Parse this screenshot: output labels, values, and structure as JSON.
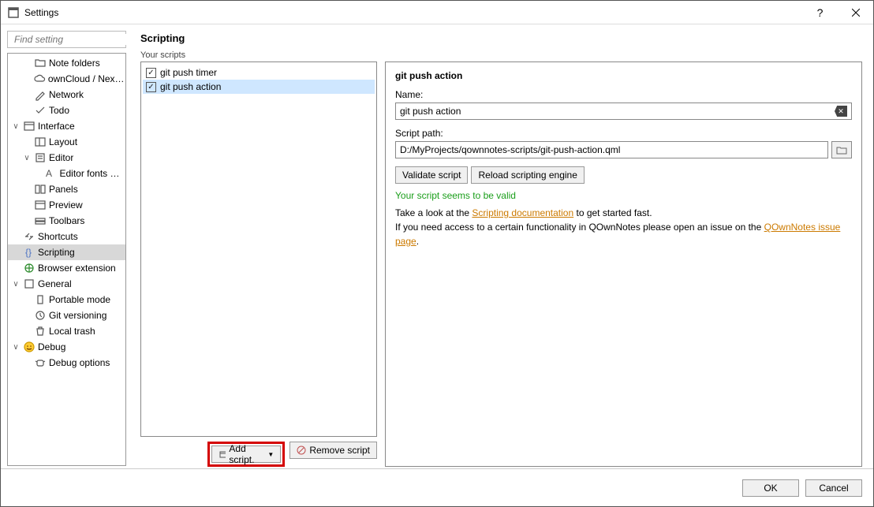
{
  "window": {
    "title": "Settings"
  },
  "search": {
    "placeholder": "Find setting"
  },
  "tree": [
    {
      "depth": 1,
      "exp": "",
      "icon": "folder",
      "label": "Note folders"
    },
    {
      "depth": 1,
      "exp": "",
      "icon": "cloud",
      "label": "ownCloud / Nextcl…"
    },
    {
      "depth": 1,
      "exp": "",
      "icon": "pencil",
      "label": "Network"
    },
    {
      "depth": 1,
      "exp": "",
      "icon": "check",
      "label": "Todo"
    },
    {
      "depth": 0,
      "exp": "∨",
      "icon": "window",
      "label": "Interface"
    },
    {
      "depth": 1,
      "exp": "",
      "icon": "layout",
      "label": "Layout"
    },
    {
      "depth": 1,
      "exp": "∨",
      "icon": "editor",
      "label": "Editor"
    },
    {
      "depth": 2,
      "exp": "",
      "icon": "font",
      "label": "Editor fonts & …"
    },
    {
      "depth": 1,
      "exp": "",
      "icon": "panels",
      "label": "Panels"
    },
    {
      "depth": 1,
      "exp": "",
      "icon": "preview",
      "label": "Preview"
    },
    {
      "depth": 1,
      "exp": "",
      "icon": "toolbar",
      "label": "Toolbars"
    },
    {
      "depth": 0,
      "exp": "",
      "icon": "shortcut",
      "label": "Shortcuts"
    },
    {
      "depth": 0,
      "exp": "",
      "icon": "script",
      "label": "Scripting",
      "selected": true
    },
    {
      "depth": 0,
      "exp": "",
      "icon": "globe",
      "label": "Browser extension"
    },
    {
      "depth": 0,
      "exp": "∨",
      "icon": "general",
      "label": "General"
    },
    {
      "depth": 1,
      "exp": "",
      "icon": "usb",
      "label": "Portable mode"
    },
    {
      "depth": 1,
      "exp": "",
      "icon": "clock",
      "label": "Git versioning"
    },
    {
      "depth": 1,
      "exp": "",
      "icon": "trash",
      "label": "Local trash"
    },
    {
      "depth": 0,
      "exp": "∨",
      "icon": "smile",
      "label": "Debug"
    },
    {
      "depth": 1,
      "exp": "",
      "icon": "bug",
      "label": "Debug options"
    }
  ],
  "main": {
    "heading": "Scripting",
    "sub": "Your scripts",
    "scripts": [
      {
        "label": "git push timer",
        "checked": true,
        "selected": false
      },
      {
        "label": "git push action",
        "checked": true,
        "selected": true
      }
    ],
    "add_label": "Add script.",
    "remove_label": "Remove script"
  },
  "detail": {
    "title": "git push action",
    "name_label": "Name:",
    "name_value": "git push action",
    "path_label": "Script path:",
    "path_value": "D:/MyProjects/qownnotes-scripts/git-push-action.qml",
    "validate": "Validate script",
    "reload": "Reload scripting engine",
    "valid_msg": "Your script seems to be valid",
    "help1a": "Take a look at the ",
    "help1_link": "Scripting documentation",
    "help1b": " to get started fast.",
    "help2a": "If you need access to a certain functionality in QOwnNotes please open an issue on the ",
    "help2_link": "QOwnNotes issue page",
    "help2b": "."
  },
  "footer": {
    "ok": "OK",
    "cancel": "Cancel"
  }
}
